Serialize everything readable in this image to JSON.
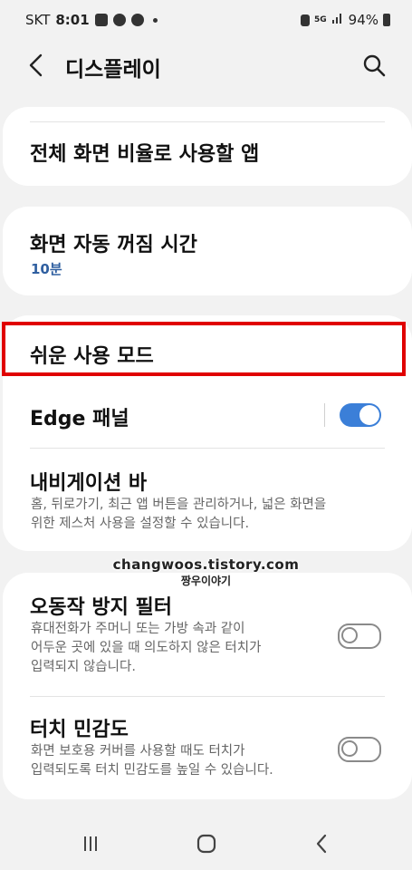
{
  "status_bar": {
    "carrier": "SKT",
    "time": "8:01",
    "battery": "94%"
  },
  "header": {
    "title": "디스플레이"
  },
  "settings": {
    "fullscreen_apps": {
      "title": "전체 화면 비율로 사용할 앱"
    },
    "screen_timeout": {
      "title": "화면 자동 꺼짐 시간",
      "value": "10분"
    },
    "easy_mode": {
      "title": "쉬운 사용 모드"
    },
    "edge_panel": {
      "title": "Edge 패널",
      "enabled": true
    },
    "navigation_bar": {
      "title": "내비게이션 바",
      "description_line1": "홈, 뒤로가기, 최근 앱 버튼을 관리하거나, 넓은 화면을",
      "description_line2": "위한 제스처 사용을 설정할 수 있습니다."
    },
    "accidental_touch": {
      "title": "오동작 방지 필터",
      "description_line1": "휴대전화가 주머니 또는 가방 속과 같이",
      "description_line2": "어두운 곳에 있을 때 의도하지 않은 터치가",
      "description_line3": "입력되지 않습니다.",
      "enabled": false
    },
    "touch_sensitivity": {
      "title": "터치 민감도",
      "description_line1": "화면 보호용 커버를 사용할 때도 터치가",
      "description_line2": "입력되도록 터치 민감도를 높일 수 있습니다.",
      "enabled": false
    }
  },
  "watermark": {
    "url": "changwoos.tistory.com",
    "name": "짱우이야기"
  },
  "colors": {
    "accent": "#3b7fd8",
    "highlight": "#e00000",
    "background": "#f2f2f2"
  }
}
